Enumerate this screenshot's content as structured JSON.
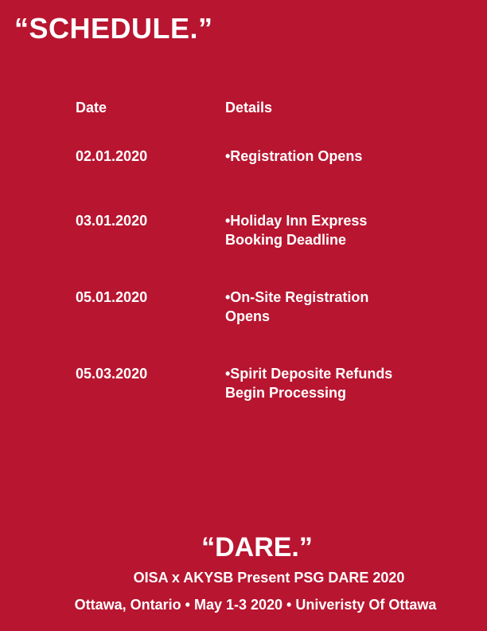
{
  "page": {
    "title": "“SCHEDULE.”",
    "background_color": "#b81530",
    "text_color": "#ffffff"
  },
  "table": {
    "headers": {
      "date": "Date",
      "details": "Details"
    },
    "rows": [
      {
        "date": "02.01.2020",
        "detail": "•Registration Opens"
      },
      {
        "date": "03.01.2020",
        "detail": "•Holiday Inn Express Booking Deadline"
      },
      {
        "date": "05.01.2020",
        "detail": "•On-Site Registration Opens"
      },
      {
        "date": "05.03.2020",
        "detail": "•Spirit Deposite Refunds Begin Processing"
      }
    ]
  },
  "footer": {
    "title": "“DARE.”",
    "subtitle": "OISA x AKYSB Present PSG DARE 2020",
    "info": "Ottawa, Ontario • May 1-3 2020 • Univeristy Of Ottawa"
  }
}
